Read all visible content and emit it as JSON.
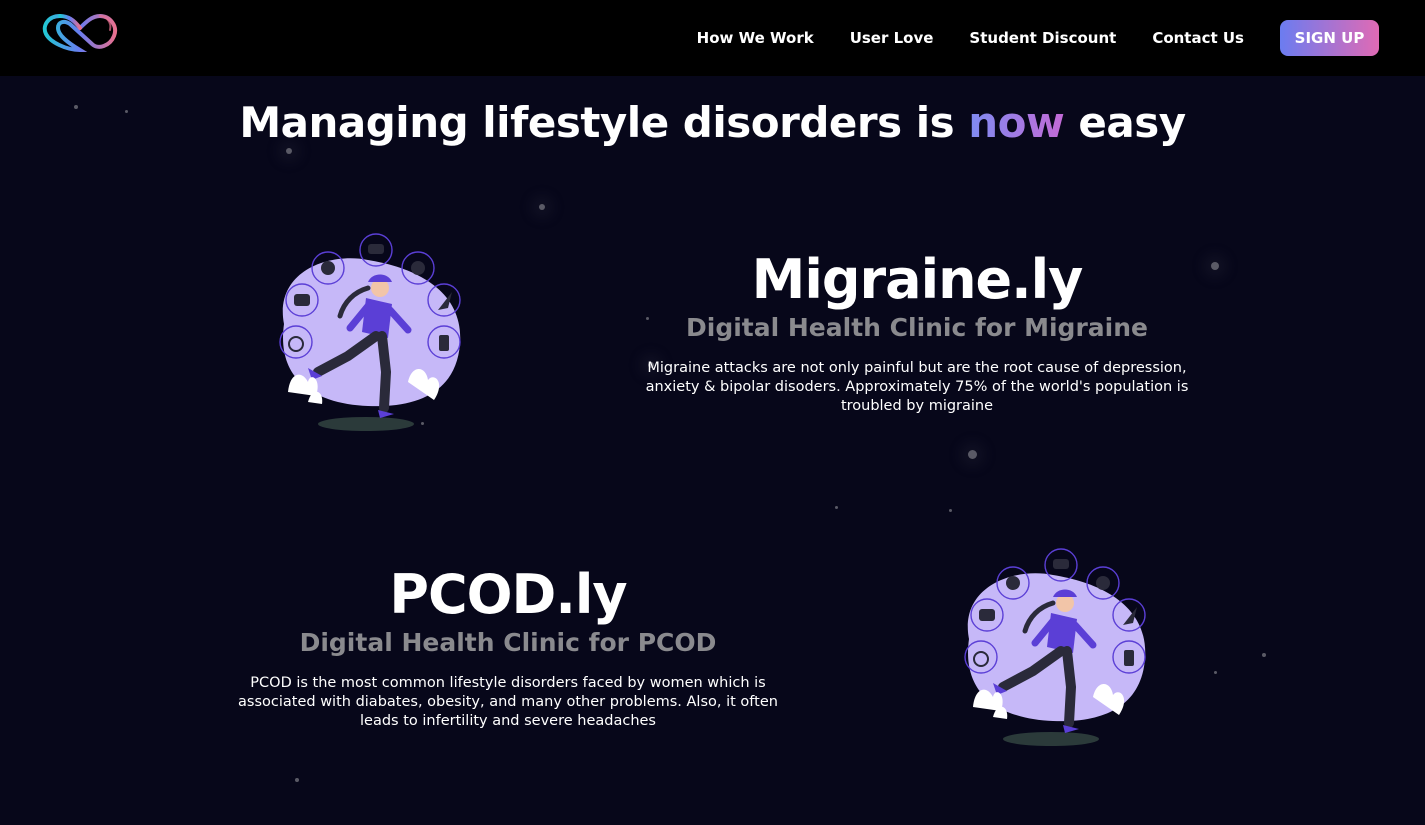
{
  "nav": {
    "links": [
      "How We Work",
      "User Love",
      "Student Discount",
      "Contact Us"
    ],
    "signup_label": "SIGN UP"
  },
  "hero": {
    "title_before": "Managing lifestyle disorders is ",
    "title_highlight": "now",
    "title_after": " easy"
  },
  "sections": [
    {
      "brand": "Migraine.ly",
      "tagline": "Digital Health Clinic for Migraine",
      "description": "Migraine attacks are not only painful but are the root cause of depression, anxiety & bipolar disoders. Approximately 75% of the world's population is troubled by migraine"
    },
    {
      "brand": "PCOD.ly",
      "tagline": "Digital Health Clinic for PCOD",
      "description": "PCOD is the most common lifestyle disorders faced by women which is associated with diabates, obesity, and many other problems. Also, it often leads to infertility and severe headaches"
    }
  ],
  "colors": {
    "background": "#07071a",
    "navbar": "#000000",
    "accent_start": "#6b7cf0",
    "accent_end": "#e06ab4",
    "tagline": "#8a8a8e",
    "blob": "#c6b8f8",
    "figure": "#5b3fd6"
  },
  "icons": [
    "heart-logo-icon",
    "runner-illustration"
  ]
}
